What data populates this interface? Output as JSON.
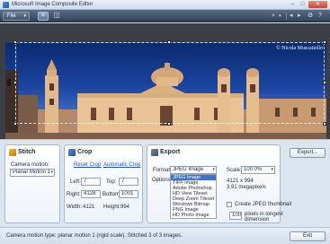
{
  "window": {
    "title": "Microsoft Image Composite Editor",
    "min": "–",
    "max": "□",
    "close": "✕"
  },
  "toolbar": {
    "file_label": "File",
    "file_caret": "▾",
    "crop_tool_glyph": "⌗",
    "tool2_glyph": "◫",
    "zoom_glyph": "⌕",
    "zoom_caret": "▾",
    "nav_left": "◂",
    "nav_right": "▸",
    "settings_glyph": "⚙",
    "help_glyph": "?"
  },
  "canvas": {
    "watermark": "© Nicola Muscatiello"
  },
  "stitch": {
    "title": "Stitch",
    "camera_motion_label": "Camera motion:",
    "camera_motion_value": "Planar Motion 1",
    "caret": "▾"
  },
  "crop": {
    "title": "Crop",
    "reset_crop": "Reset Crop",
    "automatic_crop": "Automatic Crop",
    "left_label": "Left:",
    "left_value": "7",
    "top_label": "Top:",
    "top_value": "7",
    "right_label": "Right:",
    "right_value": "4128",
    "bottom_label": "Bottom:",
    "bottom_value": "1001",
    "width_label": "Width:",
    "width_value": "4121",
    "height_label": "Height:",
    "height_value": "994"
  },
  "export": {
    "title": "Export",
    "format_label": "Format:",
    "format_value": "JPEG Image",
    "caret": "▾",
    "options_label": "Options:",
    "format_options": [
      "JPEG Image",
      "TIFF Image",
      "Adobe Photoshop",
      "HD View Tileset",
      "Deep Zoom Tileset",
      "Windows Bitmap",
      "PNG Image",
      "HD Photo Image"
    ],
    "selected_index": 0,
    "scale_label": "Scale:",
    "scale_value": "100.0%",
    "dimensions": "4121 x 994",
    "megapixels": "3.91 megapixels",
    "thumbnail_label": "Create JPEG thumbnail",
    "thumb_size": "100",
    "thumb_size_label_1": "pixels in longest",
    "thumb_size_label_2": "dimension",
    "export_button": "Export..."
  },
  "status": {
    "text": "Camera motion type: planar motion 1 (rigid scale). Stitched 3 of 3 images.",
    "exit_button": "Exit"
  }
}
